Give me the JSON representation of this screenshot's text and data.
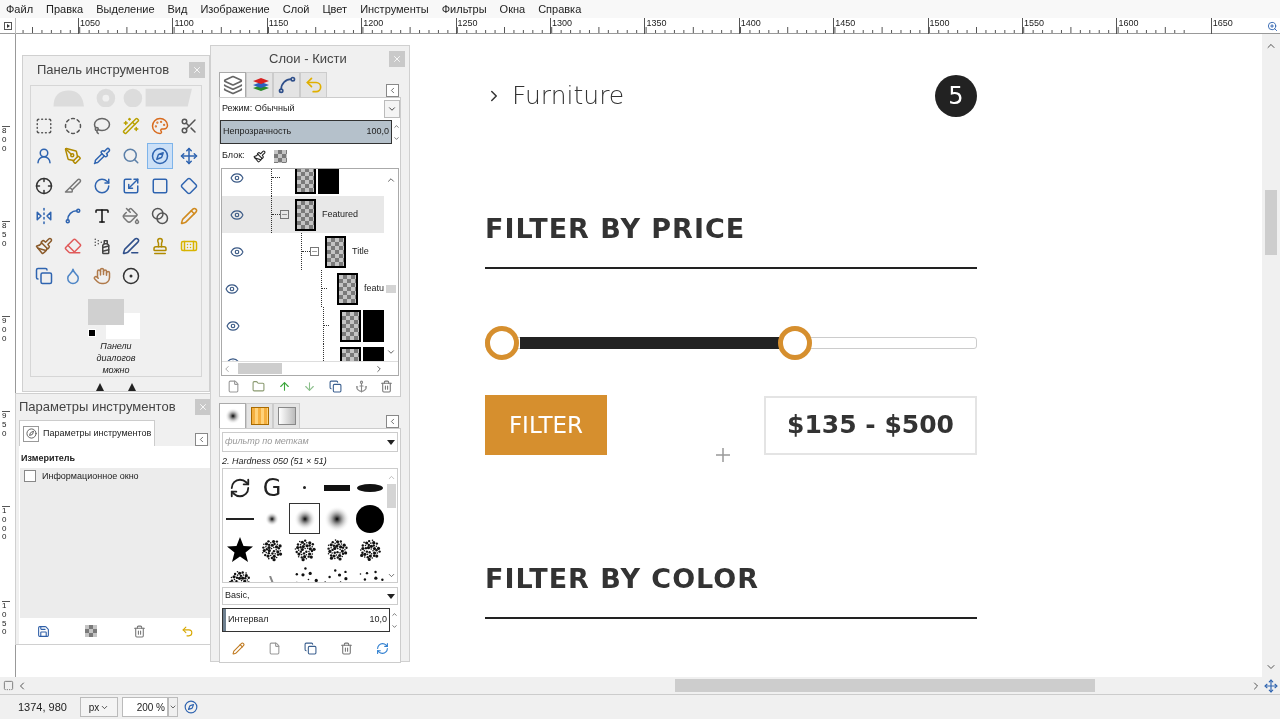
{
  "menu": [
    "Файл",
    "Правка",
    "Выделение",
    "Вид",
    "Изображение",
    "Слой",
    "Цвет",
    "Инструменты",
    "Фильтры",
    "Окна",
    "Справка"
  ],
  "top_ruler": [
    "1050",
    "1100",
    "1150",
    "1200",
    "1250",
    "1300",
    "1350",
    "1400",
    "1450",
    "1500",
    "1550",
    "1600",
    "1650"
  ],
  "left_ruler": [
    "800",
    "850",
    "900",
    "950",
    "1000",
    "1050"
  ],
  "page": {
    "categories": [
      {
        "name": "Furniture",
        "count": "5"
      }
    ],
    "price_filter": {
      "title": "FILTER BY PRICE",
      "thumbs": [
        {
          "level": 0
        },
        {
          "level": 0.64
        }
      ],
      "button": "FILTER",
      "range": "$135 - $500"
    },
    "color_filter": {
      "title": "FILTER BY COLOR"
    }
  },
  "toolbox": {
    "title": "Панель инструментов",
    "tools": [
      {
        "kind": "rect",
        "selected": false
      },
      {
        "kind": "ellipse",
        "selected": false
      },
      {
        "kind": "lasso",
        "selected": false
      },
      {
        "kind": "wand",
        "selected": false
      },
      {
        "kind": "bycolor",
        "selected": false
      },
      {
        "kind": "scissors",
        "selected": false
      },
      {
        "kind": "foreground",
        "selected": false
      },
      {
        "kind": "paths",
        "selected": false
      },
      {
        "kind": "picker",
        "selected": false
      },
      {
        "kind": "zoom",
        "selected": false
      },
      {
        "kind": "measure",
        "selected": true
      },
      {
        "kind": "move",
        "selected": false
      },
      {
        "kind": "align",
        "selected": false
      },
      {
        "kind": "crop",
        "selected": false
      },
      {
        "kind": "rotate",
        "selected": false
      },
      {
        "kind": "scale",
        "selected": false
      },
      {
        "kind": "shear",
        "selected": false
      },
      {
        "kind": "perspective",
        "selected": false
      },
      {
        "kind": "flip",
        "selected": false
      },
      {
        "kind": "cage",
        "selected": false
      },
      {
        "kind": "text",
        "selected": false
      },
      {
        "kind": "bucket",
        "selected": false
      },
      {
        "kind": "blend",
        "selected": false
      },
      {
        "kind": "pencil",
        "selected": false
      },
      {
        "kind": "brush",
        "selected": false
      },
      {
        "kind": "eraser",
        "selected": false
      },
      {
        "kind": "airbrush",
        "selected": false
      },
      {
        "kind": "ink",
        "selected": false
      },
      {
        "kind": "clone",
        "selected": false
      },
      {
        "kind": "heal",
        "selected": false
      },
      {
        "kind": "perspclone",
        "selected": false
      },
      {
        "kind": "blur",
        "selected": false
      },
      {
        "kind": "smudge",
        "selected": false
      },
      {
        "kind": "dodge",
        "selected": false
      }
    ],
    "hint": "Панели диалогов можно"
  },
  "tool_options": {
    "title": "Параметры инструментов",
    "tab": "Параметры инструментов",
    "tool_name": "Измеритель",
    "options": [
      {
        "label": "Информационное окно",
        "checked": false
      }
    ]
  },
  "dock": {
    "title": "Слои - Кисти",
    "tabs": [
      {
        "kind": "layers",
        "selected": true
      },
      {
        "kind": "channels",
        "selected": false
      },
      {
        "kind": "paths",
        "selected": false
      },
      {
        "kind": "undo",
        "selected": false
      }
    ],
    "mode": "Режим: Обычный",
    "opacity": {
      "label": "Непрозрачность",
      "value": "100,0",
      "level": 1
    },
    "lock": "Блок:",
    "layers": [
      {
        "visible": true,
        "selected": false,
        "mask": true
      },
      {
        "name": "Featured",
        "visible": true,
        "selected": true,
        "expanded": true,
        "children": [
          {
            "name": "Title",
            "visible": true,
            "selected": false,
            "expanded": true,
            "children": [
              {
                "name": "featu",
                "visible": true,
                "selected": false,
                "mask": false
              },
              {
                "visible": true,
                "selected": false,
                "mask": true
              },
              {
                "visible": true,
                "selected": false,
                "mask": true
              }
            ]
          }
        ]
      }
    ],
    "brush_tabs": [
      {
        "kind": "brushes",
        "selected": true
      },
      {
        "kind": "patterns",
        "selected": false
      },
      {
        "kind": "gradients",
        "selected": false
      }
    ],
    "brush_filter": {
      "placeholder": "фильтр по меткам"
    },
    "brush_current": "2. Hardness 050 (51 × 51)",
    "brushes": [
      {
        "kind": "refresh",
        "selected": false
      },
      {
        "kind": "letter",
        "text": "G",
        "selected": false
      },
      {
        "kind": "dot",
        "selected": false
      },
      {
        "kind": "bar",
        "selected": false
      },
      {
        "kind": "ellipse",
        "selected": false
      },
      {
        "kind": "line",
        "selected": false
      },
      {
        "kind": "soft-small",
        "selected": false
      },
      {
        "kind": "soft-medium",
        "selected": true
      },
      {
        "kind": "soft-large",
        "selected": false
      },
      {
        "kind": "disc",
        "selected": false
      },
      {
        "kind": "star",
        "selected": false
      },
      {
        "kind": "splatter",
        "selected": false
      },
      {
        "kind": "splatter",
        "selected": false
      },
      {
        "kind": "splatter",
        "selected": false
      },
      {
        "kind": "splatter",
        "selected": false
      },
      {
        "kind": "splatter",
        "selected": false
      },
      {
        "kind": "streak",
        "selected": false
      },
      {
        "kind": "scatter",
        "selected": false
      },
      {
        "kind": "scatter",
        "selected": false
      },
      {
        "kind": "scatter",
        "selected": false
      }
    ],
    "brush_tag": "Basic,",
    "spacing": {
      "label": "Интервал",
      "value": "10,0",
      "level": 0.02
    }
  },
  "status": {
    "coords": "1374, 980",
    "unit": "px",
    "zoom": "200 %"
  }
}
